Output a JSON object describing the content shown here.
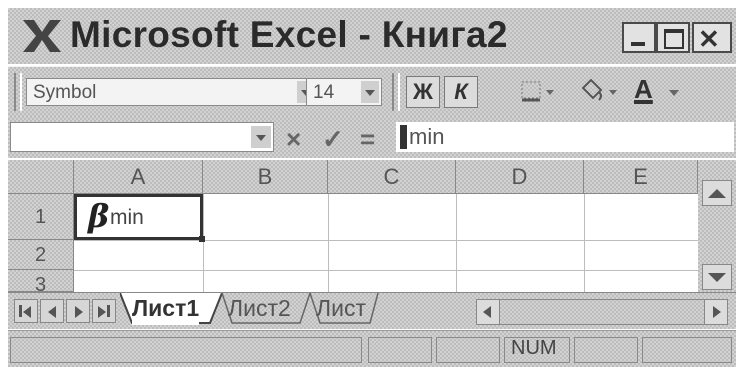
{
  "window": {
    "title": "Microsoft Excel - Книга2",
    "app_icon": "excel-x-icon",
    "controls": [
      "minimize-icon",
      "maximize-icon",
      "close-icon"
    ]
  },
  "toolbar": {
    "font_name": "Symbol",
    "font_size": "14",
    "bold_label": "Ж",
    "italic_label": "К",
    "underline_label": "A",
    "icons": [
      "borders-icon",
      "fill-color-icon",
      "font-color-icon"
    ]
  },
  "formula_bar": {
    "name_box_value": "",
    "cancel_icon": "×",
    "enter_icon": "✓",
    "equals_label": "=",
    "content": "min"
  },
  "grid": {
    "columns": [
      "A",
      "B",
      "C",
      "D",
      "E"
    ],
    "rows": [
      "1",
      "2",
      "3"
    ],
    "active_cell": "A1",
    "cell_A1_symbol": "β",
    "cell_A1_text": "min"
  },
  "sheet_tabs": {
    "tabs": [
      "Лист1",
      "Лист2",
      "Лист"
    ],
    "active_index": 0
  },
  "status_bar": {
    "num_indicator": "NUM"
  }
}
